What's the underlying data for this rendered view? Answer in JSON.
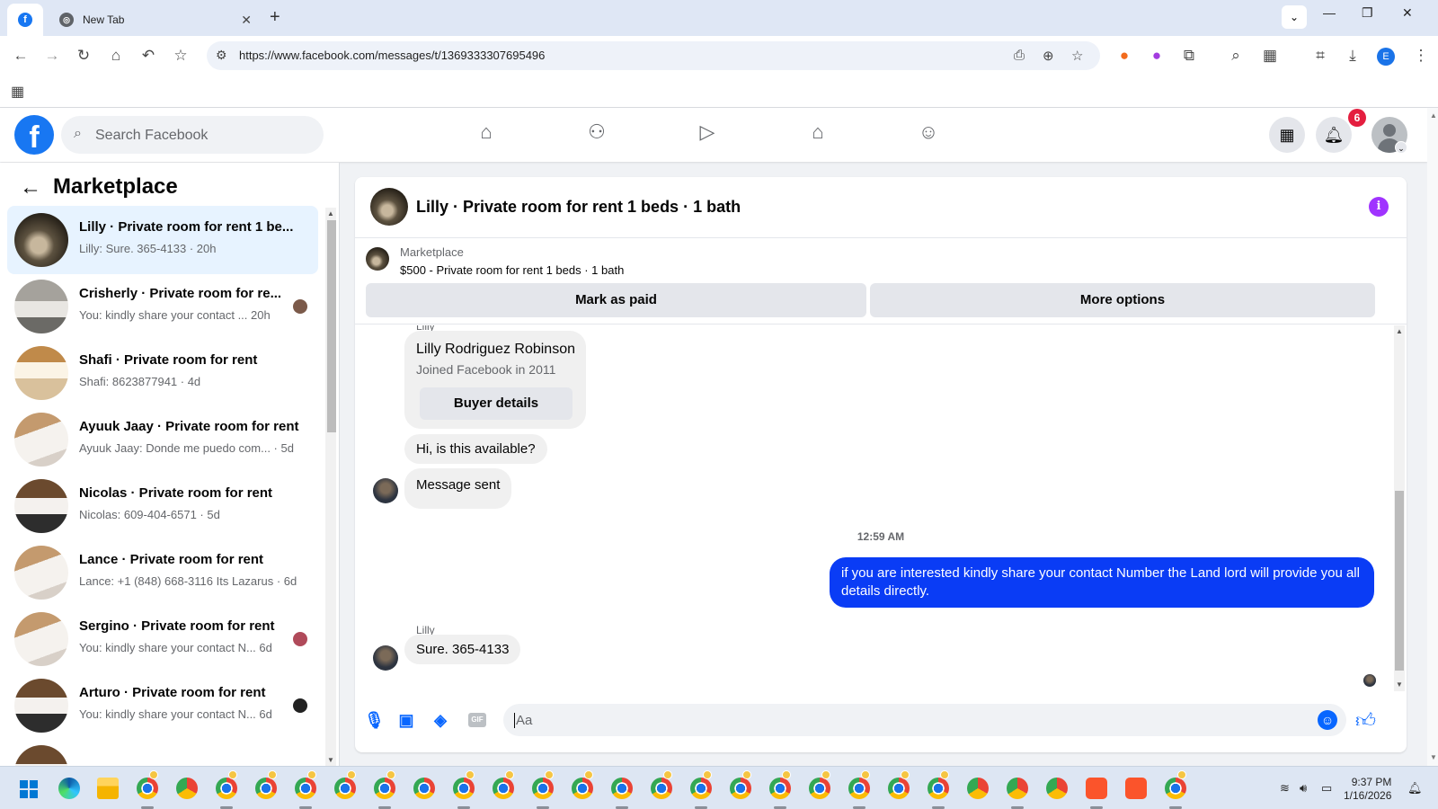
{
  "browser": {
    "active_tab_icon": "facebook-icon",
    "tab_title": "New Tab",
    "url": "https://www.facebook.com/messages/t/1369333307695496",
    "profile_initial": "E"
  },
  "fb": {
    "logo": "f",
    "search_placeholder": "Search Facebook",
    "notification_count": "6"
  },
  "sidebar": {
    "title": "Marketplace",
    "conversations": [
      {
        "name": "Lilly · Private room for rent 1 be...",
        "snippet": "Lilly: Sure. 365-4133 · 20h",
        "thumb": "room-dark"
      },
      {
        "name": "Crisherly · Private room for re...",
        "snippet": "You: kindly share your contact ...  20h",
        "thumb": "room-grey"
      },
      {
        "name": "Shafi · Private room for rent",
        "snippet": "Shafi: 8623877941 · 4d",
        "thumb": "room-wood"
      },
      {
        "name": "Ayuuk Jaay · Private room for rent",
        "snippet": "Ayuuk Jaay: Donde me puedo com... · 5d",
        "thumb": "room-white"
      },
      {
        "name": "Nicolas · Private room for rent",
        "snippet": "Nicolas: 609-404-6571 · 5d",
        "thumb": "room-bed"
      },
      {
        "name": "Lance · Private room for rent",
        "snippet": "Lance: +1 (848) 668-3116 Its Lazarus · 6d",
        "thumb": "room-white"
      },
      {
        "name": "Sergino · Private room for rent",
        "snippet": "You: kindly share your contact N...  6d",
        "thumb": "room-white"
      },
      {
        "name": "Arturo · Private room for rent",
        "snippet": "You: kindly share your contact N...  6d",
        "thumb": "room-bed"
      }
    ]
  },
  "chat": {
    "title": "Lilly · Private room for rent 1 beds · 1 bath",
    "marketplace_label": "Marketplace",
    "listing": "$500 - Private room for rent 1 beds · 1 bath",
    "mark_paid": "Mark as paid",
    "more_options": "More options",
    "sender_top": "Lilly",
    "card_name": "Lilly Rodriguez Robinson",
    "card_sub": "Joined Facebook in 2011",
    "buyer_details": "Buyer details",
    "msg1": "Hi, is this available?",
    "msg2": "Message sent",
    "timestamp": "12:59 AM",
    "outgoing": "if you are interested kindly share your contact Number the Land lord will provide you all details directly.",
    "sender_label": "Lilly",
    "reply": "Sure. 365-4133",
    "composer_placeholder": "Aa"
  },
  "taskbar": {
    "time": "9:37 PM",
    "date": "1/16/2026"
  }
}
